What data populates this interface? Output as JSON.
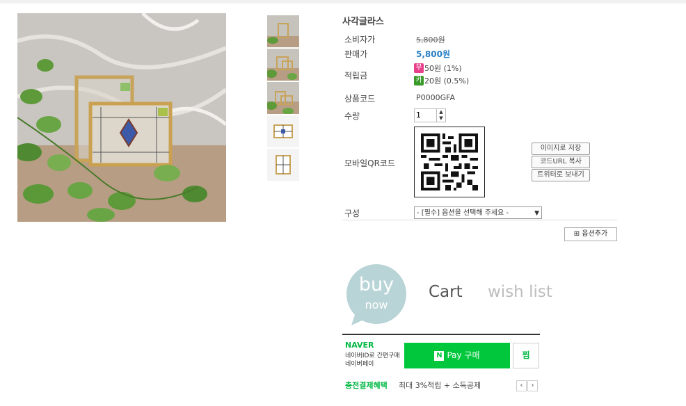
{
  "product": {
    "title": "사각글라스",
    "rows": {
      "consumer_price_label": "소비자가",
      "consumer_price": "5,800원",
      "sale_price_label": "판매가",
      "sale_price": "5,800원",
      "points_label": "적립금",
      "points_cash_badge": "무",
      "points_cash": "50원 (1%)",
      "points_card_badge": "카",
      "points_card": "20원 (0.5%)",
      "code_label": "상품코드",
      "code": "P0000GFA",
      "qty_label": "수량",
      "qty_value": "1",
      "qr_label": "모바일QR코드",
      "option_label": "구성",
      "option_select": "- [필수] 옵션을 선택해 주세요 -"
    },
    "qr_buttons": {
      "save_image": "이미지로 저장",
      "copy_url": "코드URL 복사",
      "twitter": "트위터로 보내기"
    },
    "add_option": "옵션추가"
  },
  "actions": {
    "buy": "buy",
    "buy_sub": "now",
    "cart": "Cart",
    "wish": "wish list"
  },
  "npay": {
    "logo": "NAVER",
    "desc_line1": "네이버ID로 간편구매",
    "desc_line2": "네이버페이",
    "button": "Pay 구매",
    "button_badge": "N",
    "zzim": "찜",
    "benefit_title": "충전결제혜택",
    "benefit_desc": "최대 3%적립 + 소득공제",
    "prev": "‹",
    "next": "›"
  },
  "colors": {
    "sale_price": "#2a7fc4",
    "cash_badge": "#e8408a",
    "card_badge": "#3a9a2a",
    "buy_bubble": "#b9d4d6",
    "npay_green": "#00c73c"
  }
}
